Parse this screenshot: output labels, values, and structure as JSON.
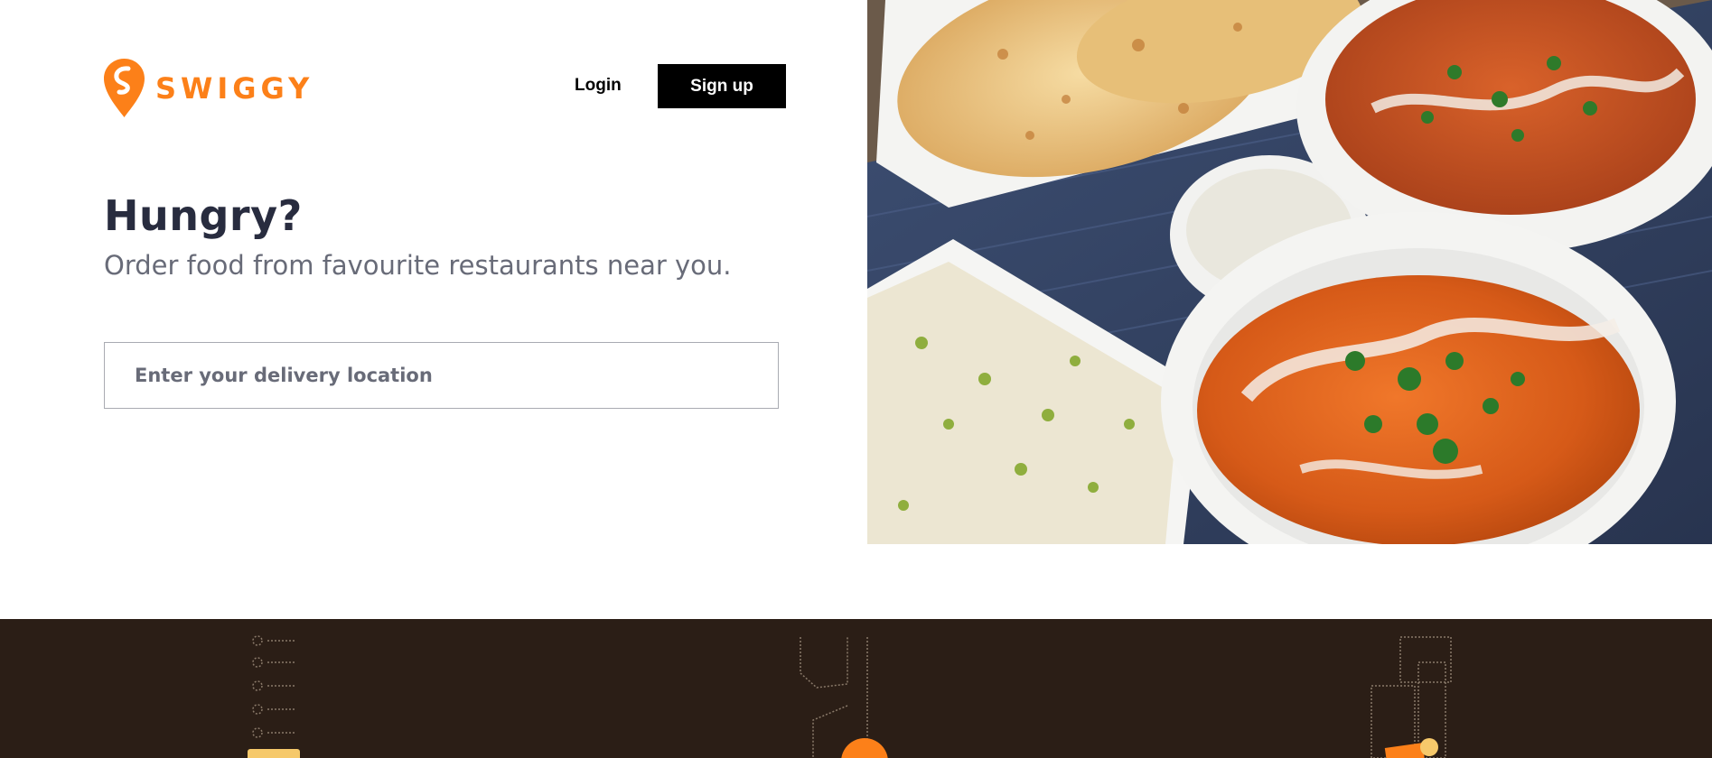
{
  "header": {
    "logo_text": "SWIGGY",
    "login_label": "Login",
    "signup_label": "Sign up"
  },
  "hero": {
    "title": "Hungry?",
    "subtitle": "Order food from favourite restaurants near you.",
    "location_placeholder": "Enter your delivery location",
    "location_value": ""
  },
  "colors": {
    "brand": "#fc8019",
    "heading": "#282c3f",
    "subtext": "#686b78",
    "dark_band": "#2b1e16",
    "button_bg": "#000000"
  },
  "icons": {
    "logo": "swiggy-pin-logo",
    "hero_image": "indian-food-photo",
    "illustrations": [
      "menu-list-illustration",
      "delivery-illustration",
      "city-buildings-illustration"
    ]
  }
}
